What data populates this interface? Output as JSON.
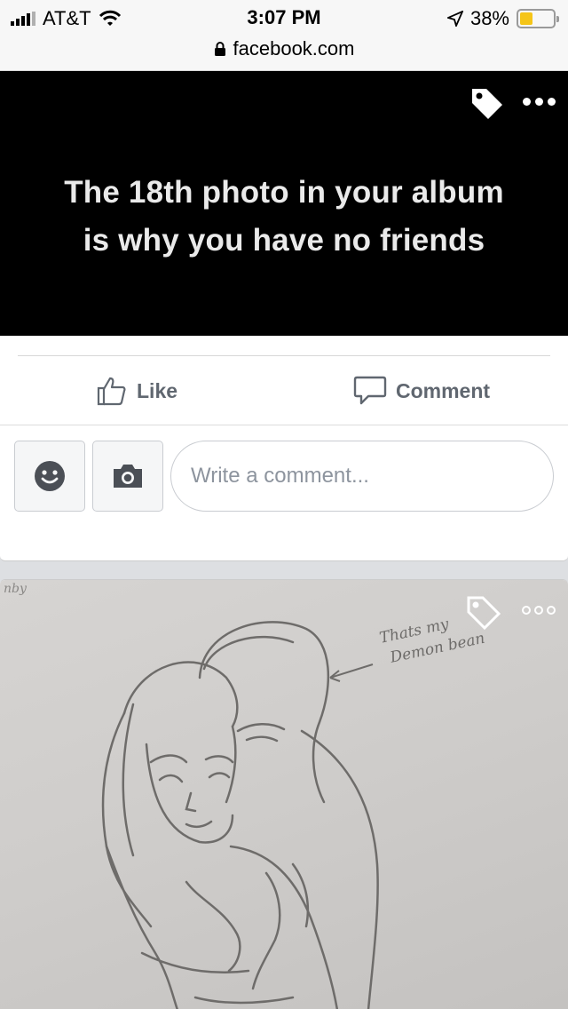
{
  "status_bar": {
    "carrier": "AT&T",
    "time": "3:07 PM",
    "battery_percent": "38%",
    "battery_level": 0.38,
    "battery_color": "#f5c518",
    "url": "facebook.com"
  },
  "post1": {
    "image_text": "The 18th photo in your album is why you have no friends",
    "tag_icon": "tag-icon",
    "more_icon": "more-icon",
    "actions": {
      "like_label": "Like",
      "comment_label": "Comment"
    },
    "composer": {
      "placeholder": "Write a comment..."
    }
  },
  "post2": {
    "handwriting_line1": "Thats my",
    "handwriting_line2": "Demon bean",
    "corner_text": "nby"
  },
  "colors": {
    "action_text": "#606770",
    "placeholder": "#8d949e",
    "icon_accent": "#4b4f56"
  }
}
